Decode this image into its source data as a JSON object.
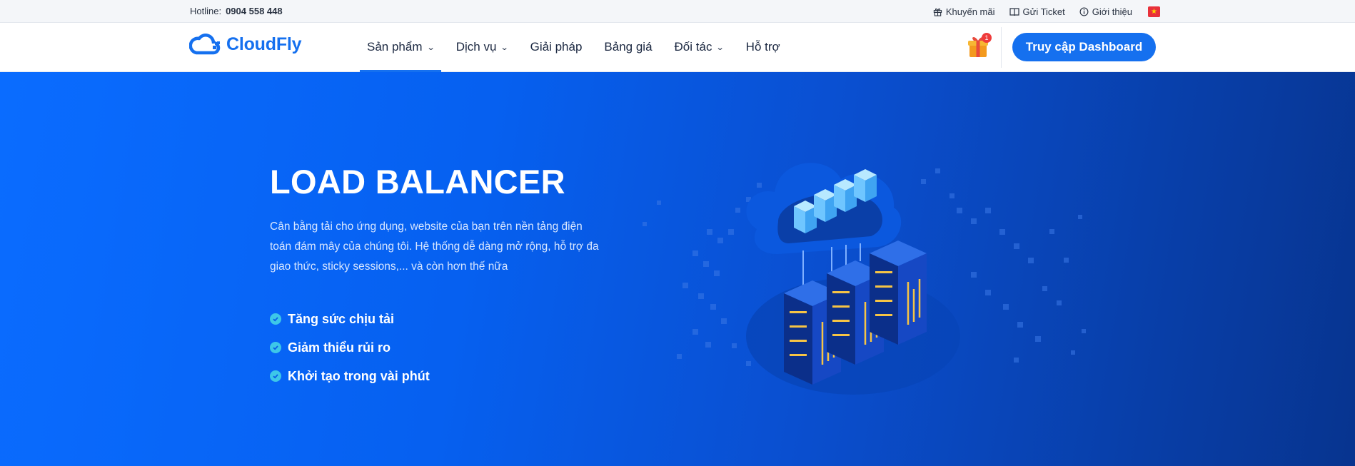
{
  "topbar": {
    "hotline_label": "Hotline:",
    "hotline_number": "0904 558 448",
    "links": [
      {
        "label": "Khuyến mãi",
        "icon": "gift-icon"
      },
      {
        "label": "Gửi Ticket",
        "icon": "book-icon"
      },
      {
        "label": "Giới thiệu",
        "icon": "info-icon"
      }
    ],
    "language_flag": "vietnam-flag-icon"
  },
  "nav": {
    "logo_text": "CloudFly",
    "menu": [
      {
        "label": "Sản phẩm",
        "has_dropdown": true,
        "active": true
      },
      {
        "label": "Dịch vụ",
        "has_dropdown": true,
        "active": false
      },
      {
        "label": "Giải pháp",
        "has_dropdown": false,
        "active": false
      },
      {
        "label": "Bảng giá",
        "has_dropdown": false,
        "active": false
      },
      {
        "label": "Đối tác",
        "has_dropdown": true,
        "active": false
      },
      {
        "label": "Hỗ trợ",
        "has_dropdown": false,
        "active": false
      }
    ],
    "gift_badge": "1",
    "dashboard_button": "Truy cập Dashboard"
  },
  "hero": {
    "title": "LOAD BALANCER",
    "description": "Cân bằng tải cho ứng dụng, website của bạn trên nền tảng điện toán đám mây của chúng tôi. Hệ thống dễ dàng mở rộng, hỗ trợ đa giao thức, sticky sessions,... và còn hơn thế nữa",
    "features": [
      "Tăng sức chịu tải",
      "Giảm thiểu rủi ro",
      "Khởi tạo trong vài phút"
    ]
  },
  "colors": {
    "brand": "#1570ef",
    "hero_start": "#0a6cff",
    "hero_end": "#07348f",
    "check": "#3dc7e8"
  }
}
